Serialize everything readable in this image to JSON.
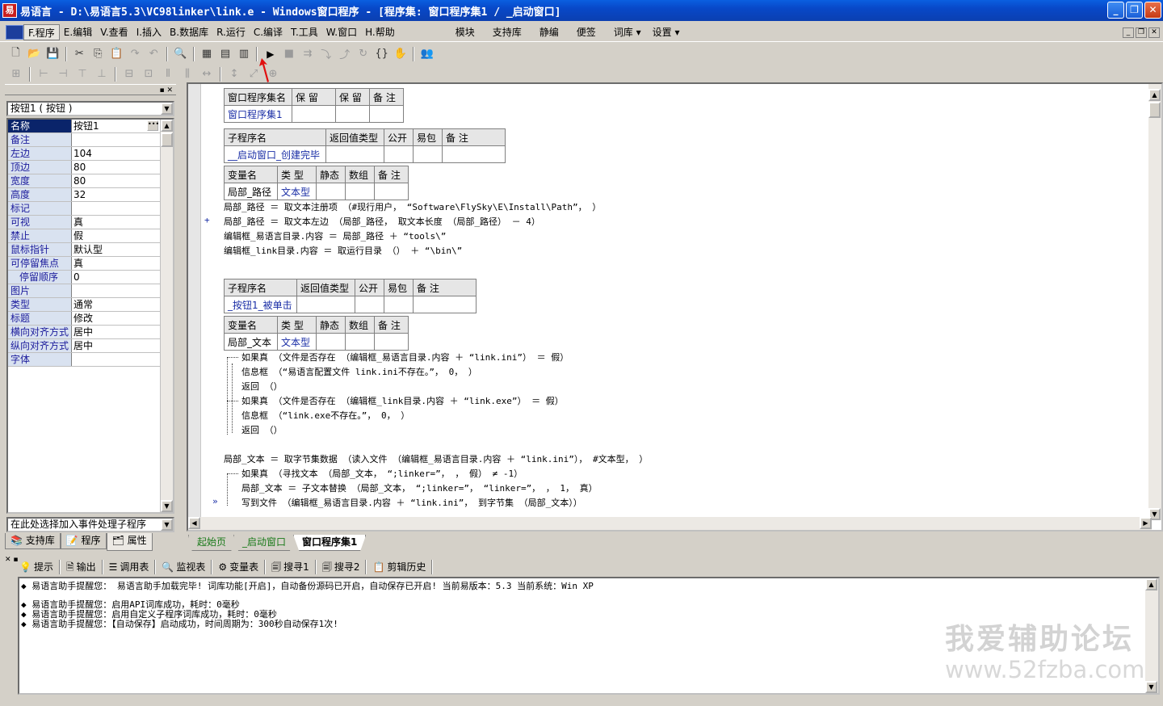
{
  "window": {
    "title": "易语言 - D:\\易语言5.3\\VC98linker\\link.e - Windows窗口程序 - [程序集: 窗口程序集1 / _启动窗口]",
    "icon": "易",
    "min": "_",
    "max": "❐",
    "close": "✕"
  },
  "menu": {
    "items": [
      "F.程序",
      "E.编辑",
      "V.查看",
      "I.插入",
      "B.数据库",
      "R.运行",
      "C.编译",
      "T.工具",
      "W.窗口",
      "H.帮助"
    ],
    "extras": [
      "模块",
      "支持库",
      "静编",
      "便签",
      "词库 ▾",
      "设置 ▾"
    ]
  },
  "left": {
    "object_combo": "按钮1 ( 按钮 )",
    "properties": [
      {
        "name": "名称",
        "value": "按钮1"
      },
      {
        "name": "备注",
        "value": ""
      },
      {
        "name": "左边",
        "value": "104"
      },
      {
        "name": "顶边",
        "value": "80"
      },
      {
        "name": "宽度",
        "value": "80"
      },
      {
        "name": "高度",
        "value": "32"
      },
      {
        "name": "标记",
        "value": ""
      },
      {
        "name": "可视",
        "value": "真"
      },
      {
        "name": "禁止",
        "value": "假"
      },
      {
        "name": "鼠标指针",
        "value": "默认型"
      },
      {
        "name": "可停留焦点",
        "value": "真"
      },
      {
        "name": "停留顺序",
        "value": "0"
      },
      {
        "name": "图片",
        "value": ""
      },
      {
        "name": "类型",
        "value": "通常"
      },
      {
        "name": "标题",
        "value": "修改"
      },
      {
        "name": "横向对齐方式",
        "value": "居中"
      },
      {
        "name": "纵向对齐方式",
        "value": "居中"
      },
      {
        "name": "字体",
        "value": ""
      }
    ],
    "event_combo": "在此处选择加入事件处理子程序",
    "tabs": [
      "支持库",
      "程序",
      "属性"
    ]
  },
  "editor": {
    "assembly_table": {
      "headers": [
        "窗口程序集名",
        "保 留",
        "保 留",
        "备 注"
      ],
      "row": [
        "窗口程序集1",
        "",
        "",
        ""
      ]
    },
    "sub1_table": {
      "headers": [
        "子程序名",
        "返回值类型",
        "公开",
        "易包",
        "备 注"
      ],
      "row": [
        "__启动窗口_创建完毕",
        "",
        "",
        "",
        ""
      ]
    },
    "var1_table": {
      "headers": [
        "变量名",
        "类 型",
        "静态",
        "数组",
        "备 注"
      ],
      "row": [
        "局部_路径",
        "文本型",
        "",
        "",
        ""
      ]
    },
    "sub1_lines": [
      "局部_路径 ＝ 取文本注册项 （#现行用户， “Software\\FlySky\\E\\Install\\Path”， ）",
      "局部_路径 ＝ 取文本左边 （局部_路径， 取文本长度 （局部_路径） － 4）",
      "编辑框_易语言目录.内容 ＝ 局部_路径 ＋ “tools\\”",
      "编辑框_link目录.内容 ＝ 取运行目录 （） ＋ “\\bin\\”"
    ],
    "sub2_table": {
      "headers": [
        "子程序名",
        "返回值类型",
        "公开",
        "易包",
        "备 注"
      ],
      "row": [
        "_按钮1_被单击",
        "",
        "",
        "",
        ""
      ]
    },
    "var2_table": {
      "headers": [
        "变量名",
        "类 型",
        "静态",
        "数组",
        "备 注"
      ],
      "row": [
        "局部_文本",
        "文本型",
        "",
        "",
        ""
      ]
    },
    "sub2_lines": [
      "如果真 （文件是否存在 （编辑框_易语言目录.内容 ＋ “link.ini”） ＝ 假）",
      "信息框 （“易语言配置文件 link.ini不存在。”， 0， ）",
      "返回 （）",
      "如果真 （文件是否存在 （编辑框_link目录.内容 ＋ “link.exe”） ＝ 假）",
      "信息框 （“link.exe不存在。”， 0， ）",
      "返回 （）",
      "局部_文本 ＝ 取字节集数据 （读入文件 （编辑框_易语言目录.内容 ＋ “link.ini”）， #文本型， ）",
      "如果真 （寻找文本 （局部_文本， “;linker=”， ， 假） ≠ -1）",
      "局部_文本 ＝ 子文本替换 （局部_文本， “;linker=”， “linker=”， ， 1， 真）",
      "写到文件 （编辑框_易语言目录.内容 ＋ “link.ini”， 到字节集 （局部_文本））"
    ],
    "tabs": [
      "起始页",
      "_启动窗口",
      "窗口程序集1"
    ]
  },
  "bottom": {
    "tabs": [
      "提示",
      "输出",
      "调用表",
      "监视表",
      "变量表",
      "搜寻1",
      "搜寻2",
      "剪辑历史"
    ],
    "output_lines": [
      "◆ 易语言助手提醒您： 易语言助手加载完毕! 词库功能[开启]，自动备份源码已开启，自动保存已开启! 当前易版本：5.3 当前系统：Win XP",
      "◆ 易语言助手提醒您：启用API词库成功，耗时：0毫秒",
      "◆ 易语言助手提醒您：启用自定义子程序词库成功，耗时：0毫秒",
      "◆ 易语言助手提醒您：【自动保存】启动成功，时间周期为：300秒自动保存1次!"
    ]
  },
  "watermark": {
    "line1": "我爱辅助论坛",
    "line2": "www.52fzba.com"
  },
  "colors": {
    "title_bar": "#0848c8",
    "keyword": "#a01414",
    "string": "#1a2ea6",
    "selection": "#0a246a"
  }
}
